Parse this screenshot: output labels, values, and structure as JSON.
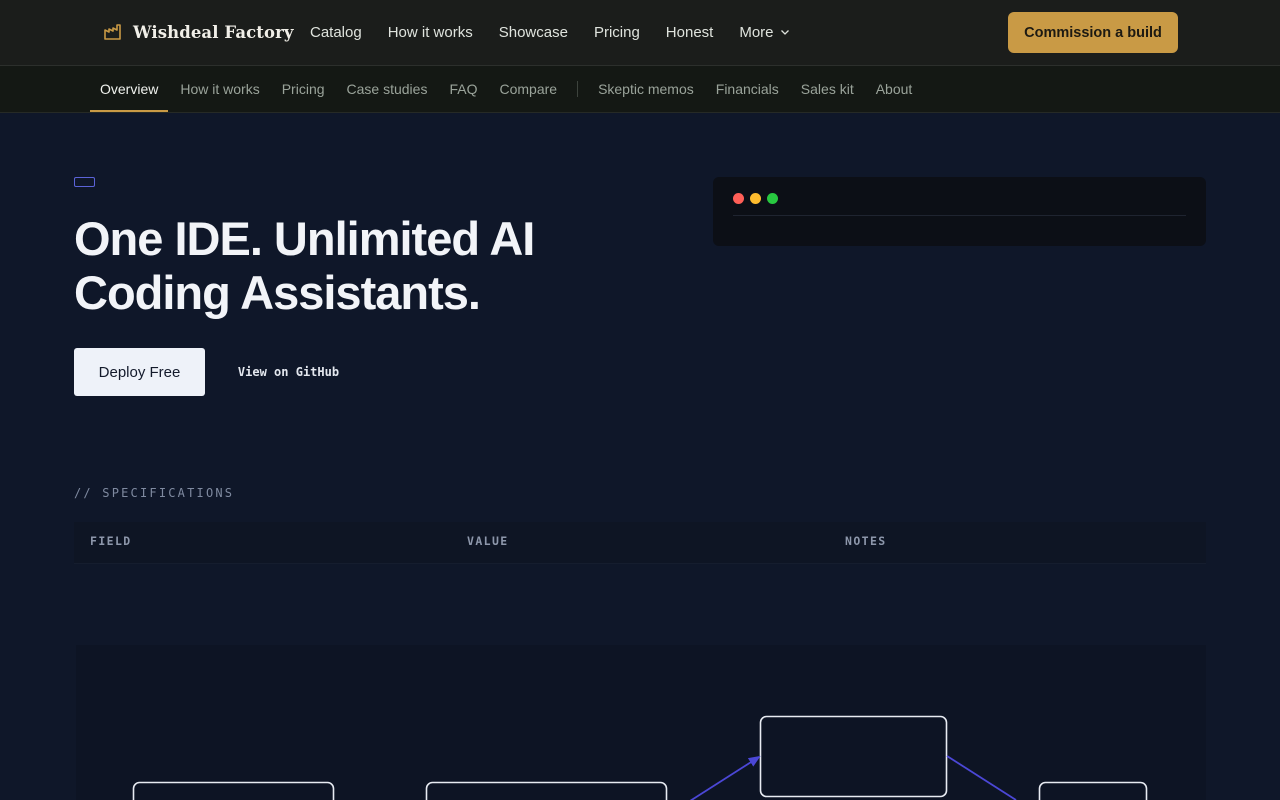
{
  "brand": {
    "name": "Wishdeal Factory",
    "icon": "factory-icon",
    "accent": "#c99a45"
  },
  "nav": {
    "items": [
      "Catalog",
      "How it works",
      "Showcase",
      "Pricing",
      "Honest"
    ],
    "more_label": "More",
    "cta_label": "Commission a build"
  },
  "subnav": {
    "primary": [
      "Overview",
      "How it works",
      "Pricing",
      "Case studies",
      "FAQ",
      "Compare"
    ],
    "secondary": [
      "Skeptic memos",
      "Financials",
      "Sales kit",
      "About"
    ],
    "active": "Overview"
  },
  "hero": {
    "title": "One IDE. Unlimited AI Coding Assistants.",
    "primary_button": "Deploy Free",
    "secondary_button": "View on GitHub"
  },
  "terminal": {
    "dot_colors": [
      "#ff5f57",
      "#febc2e",
      "#28c840"
    ]
  },
  "specs": {
    "label": "// SPECIFICATIONS",
    "columns": [
      "FIELD",
      "VALUE",
      "NOTES"
    ]
  },
  "diagram": {
    "edge_color": "#4b47d6",
    "node_border_color": "#e8ecf3"
  }
}
